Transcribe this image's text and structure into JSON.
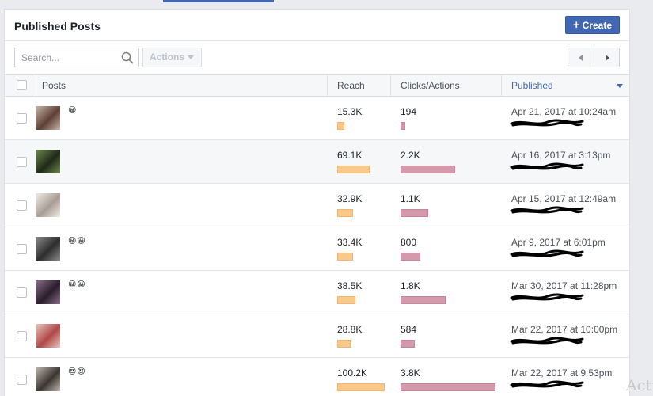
{
  "panel": {
    "title": "Published Posts",
    "create_label": "Create"
  },
  "toolbar": {
    "search_placeholder": "Search...",
    "actions_label": "Actions"
  },
  "table": {
    "columns": {
      "posts": "Posts",
      "reach": "Reach",
      "clicks": "Clicks/Actions",
      "published": "Published"
    },
    "sort_column": "Published",
    "rows": [
      {
        "emoji": "😀",
        "reach": "15.3K",
        "clicks": "194",
        "published": "Apr 21, 2017 at 10:24am",
        "reach_value": 15300,
        "clicks_value": 194,
        "thumb_colors": [
          "#c9b5a8",
          "#5d4036"
        ]
      },
      {
        "emoji": "",
        "reach": "69.1K",
        "clicks": "2.2K",
        "published": "Apr 16, 2017 at 3:13pm",
        "reach_value": 69100,
        "clicks_value": 2200,
        "thumb_colors": [
          "#6f8a4e",
          "#1f2a18"
        ]
      },
      {
        "emoji": "",
        "reach": "32.9K",
        "clicks": "1.1K",
        "published": "Apr 15, 2017 at 12:49am",
        "reach_value": 32900,
        "clicks_value": 1100,
        "thumb_colors": [
          "#f0ece8",
          "#a89d94"
        ]
      },
      {
        "emoji": "😀😀",
        "reach": "33.4K",
        "clicks": "800",
        "published": "Apr 9, 2017 at 6:01pm",
        "reach_value": 33400,
        "clicks_value": 800,
        "thumb_colors": [
          "#8c8c8c",
          "#2d2d2d"
        ]
      },
      {
        "emoji": "😀😀",
        "reach": "38.5K",
        "clicks": "1.8K",
        "published": "Mar 30, 2017 at 11:28pm",
        "reach_value": 38500,
        "clicks_value": 1800,
        "thumb_colors": [
          "#8a6f8c",
          "#2a1d2b"
        ]
      },
      {
        "emoji": "",
        "reach": "28.8K",
        "clicks": "584",
        "published": "Mar 22, 2017 at 10:00pm",
        "reach_value": 28800,
        "clicks_value": 584,
        "thumb_colors": [
          "#e9c7bf",
          "#b04848"
        ]
      },
      {
        "emoji": "😍😍",
        "reach": "100.2K",
        "clicks": "3.8K",
        "published": "Mar 22, 2017 at 9:53pm",
        "reach_value": 100200,
        "clicks_value": 3800,
        "thumb_colors": [
          "#bfb8ae",
          "#3b3530"
        ]
      }
    ]
  },
  "watermark": "Activ",
  "colors": {
    "accent": "#4267b2",
    "reach_bar": "#f9c98b",
    "clicks_bar": "#d49aab"
  },
  "icons": {
    "search": "search-icon",
    "prev": "chevron-left-icon",
    "next": "chevron-right-icon",
    "add": "plus-icon"
  }
}
